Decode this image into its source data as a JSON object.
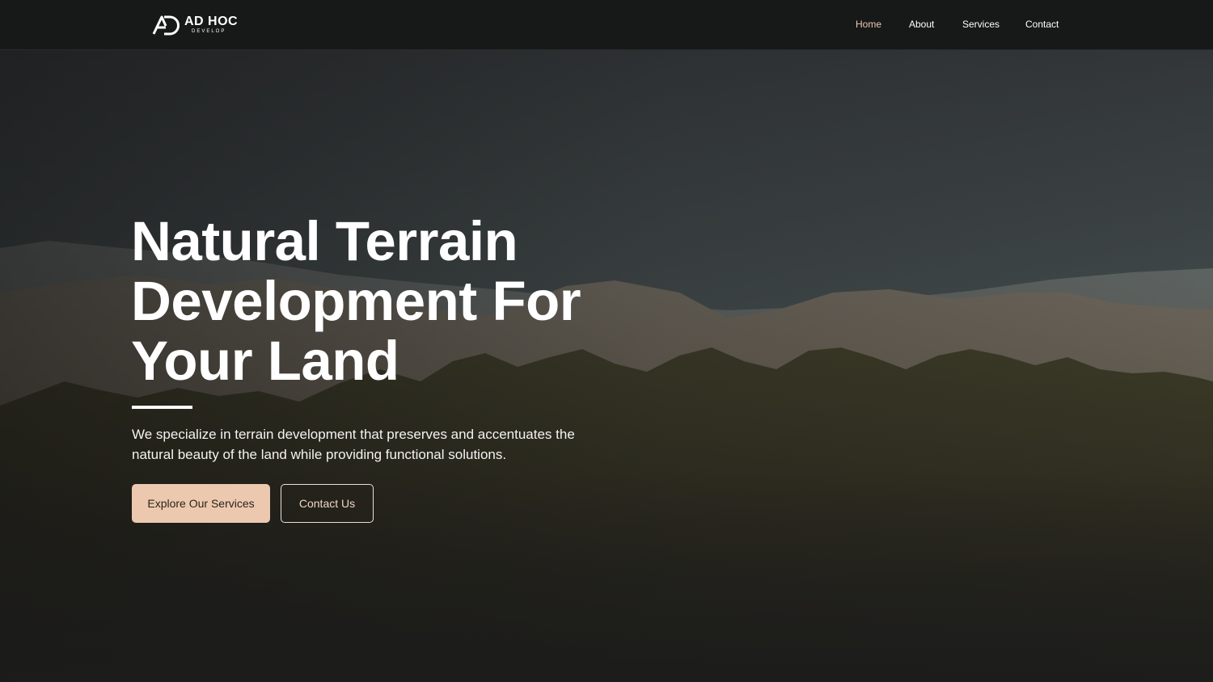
{
  "brand": {
    "name": "AD HOC",
    "tagline": "DEVELOP",
    "logo_icon": "ad-monogram-icon"
  },
  "nav": {
    "items": [
      {
        "label": "Home",
        "active": true
      },
      {
        "label": "About",
        "active": false
      },
      {
        "label": "Services",
        "active": false
      },
      {
        "label": "Contact",
        "active": false
      }
    ]
  },
  "hero": {
    "title_lines": [
      "Natural Terrain",
      "Development For",
      "Your Land"
    ],
    "description_lines": [
      "We specialize in terrain development that preserves and accentuates the",
      "natural beauty of the land while providing functional solutions."
    ],
    "primary_button": "Explore Our Services",
    "secondary_button": "Contact Us"
  },
  "colors": {
    "accent": "#ecc9ae",
    "nav_bg": "#171818",
    "text": "#ffffff"
  }
}
